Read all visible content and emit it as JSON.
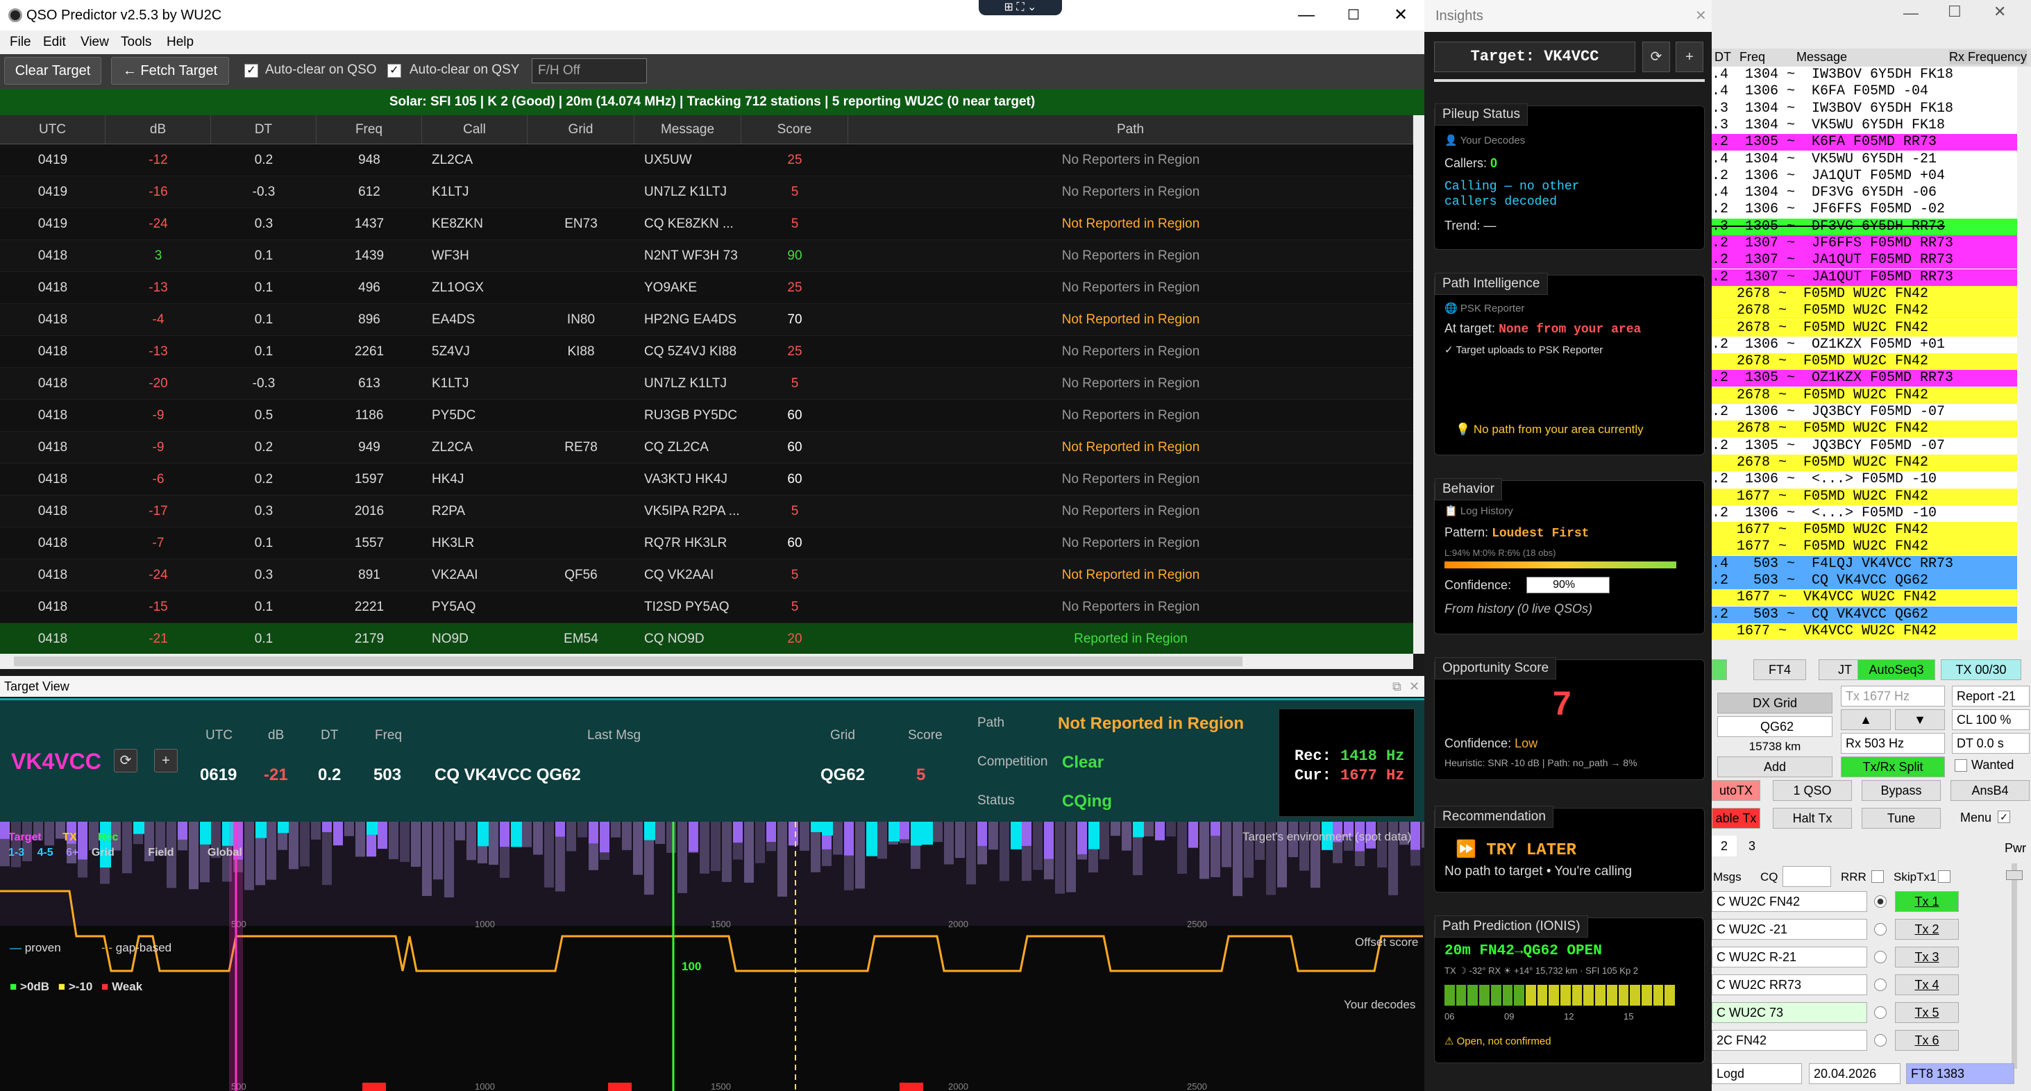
{
  "app": {
    "title": "QSO Predictor v2.5.3 by WU2C",
    "menu": [
      "File",
      "Edit",
      "View",
      "Tools",
      "Help"
    ],
    "toolbar": {
      "clear_target": "Clear Target",
      "fetch_target": "← Fetch Target",
      "auto_clear_qso": "Auto-clear on QSO",
      "auto_clear_qsy": "Auto-clear on QSY",
      "fh_value": "F/H Off"
    },
    "solar": "Solar: SFI 105 | K 2 (Good)  |  20m (14.074 MHz) | Tracking 712 stations | 5 reporting WU2C (0 near target)"
  },
  "table": {
    "columns": [
      "UTC",
      "dB",
      "DT",
      "Freq",
      "Call",
      "Grid",
      "Message",
      "Score",
      "Path"
    ],
    "rows": [
      {
        "utc": "0419",
        "db": "-12",
        "dt": "0.2",
        "freq": "948",
        "call": "ZL2CA",
        "grid": "",
        "msg": "UX5UW ZL2CA...",
        "score": "25",
        "path": "No Reporters in Region",
        "db_color": "#ff5555",
        "score_color": "#ff5555",
        "path_color": "#999999"
      },
      {
        "utc": "0419",
        "db": "-16",
        "dt": "-0.3",
        "freq": "612",
        "call": "K1LTJ",
        "grid": "",
        "msg": "UN7LZ K1LTJ ...",
        "score": "5",
        "path": "No Reporters in Region",
        "db_color": "#ff5555",
        "score_color": "#ff5555",
        "path_color": "#999999"
      },
      {
        "utc": "0419",
        "db": "-24",
        "dt": "0.3",
        "freq": "1437",
        "call": "KE8ZKN",
        "grid": "EN73",
        "msg": "CQ KE8ZKN ...",
        "score": "5",
        "path": "Not Reported in Region",
        "db_color": "#ff5555",
        "score_color": "#ff5555",
        "path_color": "#ffaa33"
      },
      {
        "utc": "0418",
        "db": "3",
        "dt": "0.1",
        "freq": "1439",
        "call": "WF3H",
        "grid": "",
        "msg": "N2NT WF3H 73",
        "score": "90",
        "path": "No Reporters in Region",
        "db_color": "#44dd44",
        "score_color": "#44dd44",
        "path_color": "#999999"
      },
      {
        "utc": "0418",
        "db": "-13",
        "dt": "0.1",
        "freq": "496",
        "call": "ZL1OGX",
        "grid": "",
        "msg": "YO9AKE ZL1O...",
        "score": "25",
        "path": "No Reporters in Region",
        "db_color": "#ff5555",
        "score_color": "#ff5555",
        "path_color": "#999999"
      },
      {
        "utc": "0418",
        "db": "-4",
        "dt": "0.1",
        "freq": "896",
        "call": "EA4DS",
        "grid": "IN80",
        "msg": "HP2NG EA4DS ...",
        "score": "70",
        "path": "Not Reported in Region",
        "db_color": "#ff5555",
        "score_color": "#ffffff",
        "path_color": "#ffaa33"
      },
      {
        "utc": "0418",
        "db": "-13",
        "dt": "0.1",
        "freq": "2261",
        "call": "5Z4VJ",
        "grid": "KI88",
        "msg": "CQ 5Z4VJ KI88",
        "score": "25",
        "path": "No Reporters in Region",
        "db_color": "#ff5555",
        "score_color": "#ff5555",
        "path_color": "#999999"
      },
      {
        "utc": "0418",
        "db": "-20",
        "dt": "-0.3",
        "freq": "613",
        "call": "K1LTJ",
        "grid": "",
        "msg": "UN7LZ K1LTJ ...",
        "score": "5",
        "path": "No Reporters in Region",
        "db_color": "#ff5555",
        "score_color": "#ff5555",
        "path_color": "#999999"
      },
      {
        "utc": "0418",
        "db": "-9",
        "dt": "0.5",
        "freq": "1186",
        "call": "PY5DC",
        "grid": "",
        "msg": "RU3GB PY5DC ...",
        "score": "60",
        "path": "No Reporters in Region",
        "db_color": "#ff5555",
        "score_color": "#ffffff",
        "path_color": "#999999"
      },
      {
        "utc": "0418",
        "db": "-9",
        "dt": "0.2",
        "freq": "949",
        "call": "ZL2CA",
        "grid": "RE78",
        "msg": "CQ ZL2CA RE78",
        "score": "60",
        "path": "Not Reported in Region",
        "db_color": "#ff5555",
        "score_color": "#ffffff",
        "path_color": "#ffaa33"
      },
      {
        "utc": "0418",
        "db": "-6",
        "dt": "0.2",
        "freq": "1597",
        "call": "HK4J",
        "grid": "",
        "msg": "VA3KTJ HK4J -12",
        "score": "60",
        "path": "No Reporters in Region",
        "db_color": "#ff5555",
        "score_color": "#ffffff",
        "path_color": "#999999"
      },
      {
        "utc": "0418",
        "db": "-17",
        "dt": "0.3",
        "freq": "2016",
        "call": "R2PA",
        "grid": "",
        "msg": "VK5IPA R2PA ...",
        "score": "5",
        "path": "No Reporters in Region",
        "db_color": "#ff5555",
        "score_color": "#ff5555",
        "path_color": "#999999"
      },
      {
        "utc": "0418",
        "db": "-7",
        "dt": "0.1",
        "freq": "1557",
        "call": "HK3LR",
        "grid": "",
        "msg": "RQ7R HK3LR 73",
        "score": "60",
        "path": "No Reporters in Region",
        "db_color": "#ff5555",
        "score_color": "#ffffff",
        "path_color": "#999999"
      },
      {
        "utc": "0418",
        "db": "-24",
        "dt": "0.3",
        "freq": "891",
        "call": "VK2AAI",
        "grid": "QF56",
        "msg": "CQ VK2AAI QF56",
        "score": "5",
        "path": "Not Reported in Region",
        "db_color": "#ff5555",
        "score_color": "#ff5555",
        "path_color": "#ffaa33"
      },
      {
        "utc": "0418",
        "db": "-15",
        "dt": "0.1",
        "freq": "2221",
        "call": "PY5AQ",
        "grid": "",
        "msg": "TI2SD PY5AQ ...",
        "score": "5",
        "path": "No Reporters in Region",
        "db_color": "#ff5555",
        "score_color": "#ff5555",
        "path_color": "#999999"
      },
      {
        "utc": "0418",
        "db": "-21",
        "dt": "0.1",
        "freq": "2179",
        "call": "NO9D",
        "grid": "EM54",
        "msg": "CQ NO9D EM54",
        "score": "20",
        "path": "Reported in Region",
        "db_color": "#ff5555",
        "score_color": "#ff5555",
        "path_color": "#44dd44"
      }
    ]
  },
  "target_view": {
    "title": "Target View",
    "callsign": "VK4VCC",
    "labels": {
      "utc": "UTC",
      "db": "dB",
      "dt": "DT",
      "freq": "Freq",
      "last_msg": "Last Msg",
      "grid": "Grid",
      "score": "Score",
      "path": "Path",
      "competition": "Competition",
      "status": "Status"
    },
    "utc": "0619",
    "db": "-21",
    "dt": "0.2",
    "freq": "503",
    "last_msg": "CQ VK4VCC QG62",
    "grid": "QG62",
    "score": "5",
    "path": "Not Reported in Region",
    "competition": "Clear",
    "status": "CQing",
    "rec": "Rec:",
    "rec_val": "1418 Hz",
    "cur": "Cur:",
    "cur_val": "1677 Hz",
    "legend1": [
      "Target",
      "TX",
      "Rec"
    ],
    "legend2": [
      "1-3",
      "4-5",
      "6+",
      "Grid",
      "Field",
      "Global"
    ],
    "env_label": "Target's environment (spot data)",
    "proven": "proven",
    "gap_based": "gap-based",
    "offset_score": "Offset score",
    "your_decodes": "Your decodes",
    "snr_legend": [
      ">0dB",
      ">-10",
      "Weak"
    ],
    "axis": [
      "500",
      "1000",
      "1500",
      "2000",
      "2500"
    ],
    "score_mark": "100"
  },
  "insights": {
    "title": "Insights",
    "target": "Target: VK4VCC",
    "pileup": {
      "title": "Pileup Status",
      "src": "Your Decodes",
      "callers_label": "Callers:",
      "callers": "0",
      "msg1": "Calling — no other",
      "msg2": "callers decoded",
      "trend": "Trend: —"
    },
    "path": {
      "title": "Path Intelligence",
      "src": "PSK Reporter",
      "at_target": "At target:",
      "none": "None from your area",
      "uploads": "✓ Target uploads to PSK Reporter",
      "nopath": "No path from your area currently"
    },
    "behavior": {
      "title": "Behavior",
      "src": "Log History",
      "pattern_label": "Pattern:",
      "pattern": "Loudest First",
      "stats": "L:94% M:0% R:6% (18 obs)",
      "conf_label": "Confidence:",
      "conf": "90%",
      "from": "From history (0 live QSOs)"
    },
    "opp": {
      "title": "Opportunity Score",
      "value": "7",
      "conf_label": "Confidence:",
      "conf": "Low",
      "heur": "Heuristic: SNR -10 dB | Path: no_path → 8%"
    },
    "rec": {
      "title": "Recommendation",
      "action": "TRY LATER",
      "msg": "No path to target • You're calling"
    },
    "ionis": {
      "title": "Path Prediction (IONIS)",
      "head": "20m FN42→QG62 OPEN",
      "sub": "TX ☽ -32°  RX ☀ +14°  15,732 km · SFI 105 Kp 2",
      "ticks": [
        "06",
        "09",
        "12",
        "15"
      ],
      "warn": "Open, not confirmed"
    }
  },
  "wsjt": {
    "header": [
      "DT",
      "Freq",
      "Message"
    ],
    "rx_freq": "Rx Frequency",
    "decodes": [
      {
        "t": ".4  1304 ~  IW3BOV 6Y5DH FK18",
        "bg": "#ffffff",
        "strike": false
      },
      {
        "t": ".4  1306 ~  K6FA F05MD -04",
        "bg": "#ffffff",
        "strike": false
      },
      {
        "t": ".3  1304 ~  IW3BOV 6Y5DH FK18",
        "bg": "#ffffff",
        "strike": false
      },
      {
        "t": ".3  1304 ~  VK5WU 6Y5DH FK18",
        "bg": "#ffffff",
        "strike": false
      },
      {
        "t": ".2  1305 ~  K6FA F05MD RR73",
        "bg": "#ff33ff",
        "strike": false
      },
      {
        "t": ".4  1304 ~  VK5WU 6Y5DH -21",
        "bg": "#ffffff",
        "strike": false
      },
      {
        "t": ".2  1306 ~  JA1QUT F05MD +04",
        "bg": "#ffffff",
        "strike": false
      },
      {
        "t": ".4  1304 ~  DF3VG 6Y5DH -06",
        "bg": "#ffffff",
        "strike": false
      },
      {
        "t": ".2  1306 ~  JF6FFS F05MD -02",
        "bg": "#ffffff",
        "strike": false
      },
      {
        "t": ".3  1305 ~  DF3VG 6Y5DH RR73",
        "bg": "#33ff33",
        "strike": true
      },
      {
        "t": ".2  1307 ~  JF6FFS F05MD RR73",
        "bg": "#ff33ff",
        "strike": false
      },
      {
        "t": ".2  1307 ~  JA1QUT F05MD RR73",
        "bg": "#ff33ff",
        "strike": false
      },
      {
        "t": ".2  1307 ~  JA1QUT F05MD RR73",
        "bg": "#ff33ff",
        "strike": false
      },
      {
        "t": "   2678 ~  F05MD WU2C FN42",
        "bg": "#ffff33",
        "strike": false
      },
      {
        "t": "   2678 ~  F05MD WU2C FN42",
        "bg": "#ffff33",
        "strike": false
      },
      {
        "t": "   2678 ~  F05MD WU2C FN42",
        "bg": "#ffff33",
        "strike": false
      },
      {
        "t": ".2  1306 ~  OZ1KZX F05MD +01",
        "bg": "#ffffff",
        "strike": false
      },
      {
        "t": "   2678 ~  F05MD WU2C FN42",
        "bg": "#ffff33",
        "strike": false
      },
      {
        "t": ".2  1305 ~  OZ1KZX F05MD RR73",
        "bg": "#ff33ff",
        "strike": false
      },
      {
        "t": "   2678 ~  F05MD WU2C FN42",
        "bg": "#ffff33",
        "strike": false
      },
      {
        "t": ".2  1306 ~  JQ3BCY F05MD -07",
        "bg": "#ffffff",
        "strike": false
      },
      {
        "t": "   2678 ~  F05MD WU2C FN42",
        "bg": "#ffff33",
        "strike": false
      },
      {
        "t": ".2  1305 ~  JQ3BCY F05MD -07",
        "bg": "#ffffff",
        "strike": false
      },
      {
        "t": "   2678 ~  F05MD WU2C FN42",
        "bg": "#ffff33",
        "strike": false
      },
      {
        "t": ".2  1306 ~  <...> F05MD -10",
        "bg": "#ffffff",
        "strike": false
      },
      {
        "t": "   1677 ~  F05MD WU2C FN42",
        "bg": "#ffff33",
        "strike": false
      },
      {
        "t": ".2  1306 ~  <...> F05MD -10",
        "bg": "#ffffff",
        "strike": false
      },
      {
        "t": "   1677 ~  F05MD WU2C FN42",
        "bg": "#ffff33",
        "strike": false
      },
      {
        "t": "   1677 ~  F05MD WU2C FN42",
        "bg": "#ffff33",
        "strike": false
      },
      {
        "t": ".4   503 ~  F4LQJ VK4VCC RR73",
        "bg": "#55aaff",
        "strike": false
      },
      {
        "t": ".2   503 ~  CQ VK4VCC QG62",
        "bg": "#55aaff",
        "strike": false
      },
      {
        "t": "   1677 ~  VK4VCC WU2C FN42",
        "bg": "#ffff33",
        "strike": false
      },
      {
        "t": ".2   503 ~  CQ VK4VCC QG62",
        "bg": "#55aaff",
        "strike": false
      },
      {
        "t": "   1677 ~  VK4VCC WU2C FN42",
        "bg": "#ffff33",
        "strike": false
      }
    ],
    "buttons": {
      "ft4": "FT4",
      "jt": "JT",
      "autoseq": "AutoSeq3",
      "tx0030": "TX 00/30",
      "dxgrid": "DX Grid",
      "grid_val": "QG62",
      "dist": "15738 km",
      "add": "Add",
      "tx_hz": "Tx 1677 Hz",
      "rx_hz": "Rx 503 Hz",
      "txrxsplit": "Tx/Rx Split",
      "report": "Report -21",
      "cl": "CL 100 %",
      "dtval": "DT 0.0 s",
      "wanted": "Wanted",
      "autotx": "utoTX",
      "oneqso": "1 QSO",
      "bypass": "Bypass",
      "ansb4": "AnsB4",
      "enable_tx": "able Tx",
      "halt": "Halt Tx",
      "tune": "Tune",
      "menu": "Menu",
      "tab2": "2",
      "tab3": "3",
      "msgs": "Msgs",
      "cq": "CQ",
      "rrr": "RRR",
      "skiptx1": "SkipTx1",
      "pwr": "Pwr",
      "logd": "Logd",
      "date": "20.04.2026",
      "mode": "FT8  1383"
    },
    "tx_msgs": [
      "C WU2C FN42",
      "C WU2C -21",
      "C WU2C R-21",
      "C WU2C RR73",
      "C WU2C 73",
      "2C FN42"
    ],
    "tx_labels": [
      "Tx 1",
      "Tx 2",
      "Tx 3",
      "Tx 4",
      "Tx 5",
      "Tx 6"
    ]
  }
}
